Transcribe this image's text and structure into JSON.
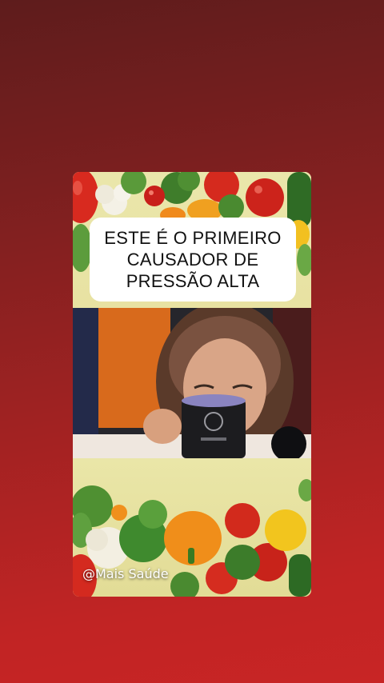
{
  "caption": {
    "line1": "ESTE É O PRIMEIRO",
    "line2": "CAUSADOR DE",
    "line3": "PRESSÃO ALTA"
  },
  "watermark": {
    "handle": "@Mais Saúde"
  },
  "colors": {
    "background_top": "#5e1c1c",
    "background_bottom": "#c82525",
    "caption_bg": "#ffffff",
    "caption_text": "#111111",
    "veg_background": "#e9e3a6"
  },
  "icons": [
    "vegetables-image",
    "person-drinking-image"
  ]
}
